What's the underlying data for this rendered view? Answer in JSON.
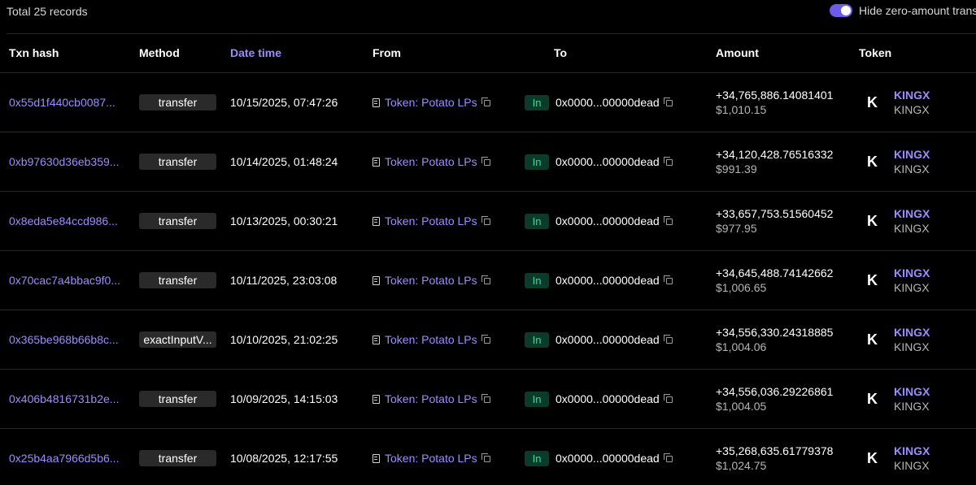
{
  "summary": {
    "total_records": "Total 25 records",
    "hide_zero_label": "Hide zero-amount trans"
  },
  "colors": {
    "accent": "#9b8cff",
    "toggle_on": "#6c5ce7",
    "in_badge_bg": "#0b3b2a",
    "in_badge_text": "#3fd596",
    "background": "#000000"
  },
  "columns": {
    "txn_hash": "Txn hash",
    "method": "Method",
    "date_time": "Date time",
    "from": "From",
    "to": "To",
    "amount": "Amount",
    "token": "Token"
  },
  "rows": [
    {
      "hash": "0x55d1f440cb0087...",
      "method": "transfer",
      "datetime": "10/15/2025, 07:47:26",
      "from": "Token: Potato LPs",
      "direction": "In",
      "to": "0x0000...00000dead",
      "amount": "+34,765,886.14081401",
      "usd": "$1,010.15",
      "token_logo": "K",
      "token_symbol": "KINGX",
      "token_name": "KINGX"
    },
    {
      "hash": "0xb97630d36eb359...",
      "method": "transfer",
      "datetime": "10/14/2025, 01:48:24",
      "from": "Token: Potato LPs",
      "direction": "In",
      "to": "0x0000...00000dead",
      "amount": "+34,120,428.76516332",
      "usd": "$991.39",
      "token_logo": "K",
      "token_symbol": "KINGX",
      "token_name": "KINGX"
    },
    {
      "hash": "0x8eda5e84ccd986...",
      "method": "transfer",
      "datetime": "10/13/2025, 00:30:21",
      "from": "Token: Potato LPs",
      "direction": "In",
      "to": "0x0000...00000dead",
      "amount": "+33,657,753.51560452",
      "usd": "$977.95",
      "token_logo": "K",
      "token_symbol": "KINGX",
      "token_name": "KINGX"
    },
    {
      "hash": "0x70cac7a4bbac9f0...",
      "method": "transfer",
      "datetime": "10/11/2025, 23:03:08",
      "from": "Token: Potato LPs",
      "direction": "In",
      "to": "0x0000...00000dead",
      "amount": "+34,645,488.74142662",
      "usd": "$1,006.65",
      "token_logo": "K",
      "token_symbol": "KINGX",
      "token_name": "KINGX"
    },
    {
      "hash": "0x365be968b66b8c...",
      "method": "exactInputV...",
      "datetime": "10/10/2025, 21:02:25",
      "from": "Token: Potato LPs",
      "direction": "In",
      "to": "0x0000...00000dead",
      "amount": "+34,556,330.24318885",
      "usd": "$1,004.06",
      "token_logo": "K",
      "token_symbol": "KINGX",
      "token_name": "KINGX"
    },
    {
      "hash": "0x406b4816731b2e...",
      "method": "transfer",
      "datetime": "10/09/2025, 14:15:03",
      "from": "Token: Potato LPs",
      "direction": "In",
      "to": "0x0000...00000dead",
      "amount": "+34,556,036.29226861",
      "usd": "$1,004.05",
      "token_logo": "K",
      "token_symbol": "KINGX",
      "token_name": "KINGX"
    },
    {
      "hash": "0x25b4aa7966d5b6...",
      "method": "transfer",
      "datetime": "10/08/2025, 12:17:55",
      "from": "Token: Potato LPs",
      "direction": "In",
      "to": "0x0000...00000dead",
      "amount": "+35,268,635.61779378",
      "usd": "$1,024.75",
      "token_logo": "K",
      "token_symbol": "KINGX",
      "token_name": "KINGX"
    }
  ]
}
